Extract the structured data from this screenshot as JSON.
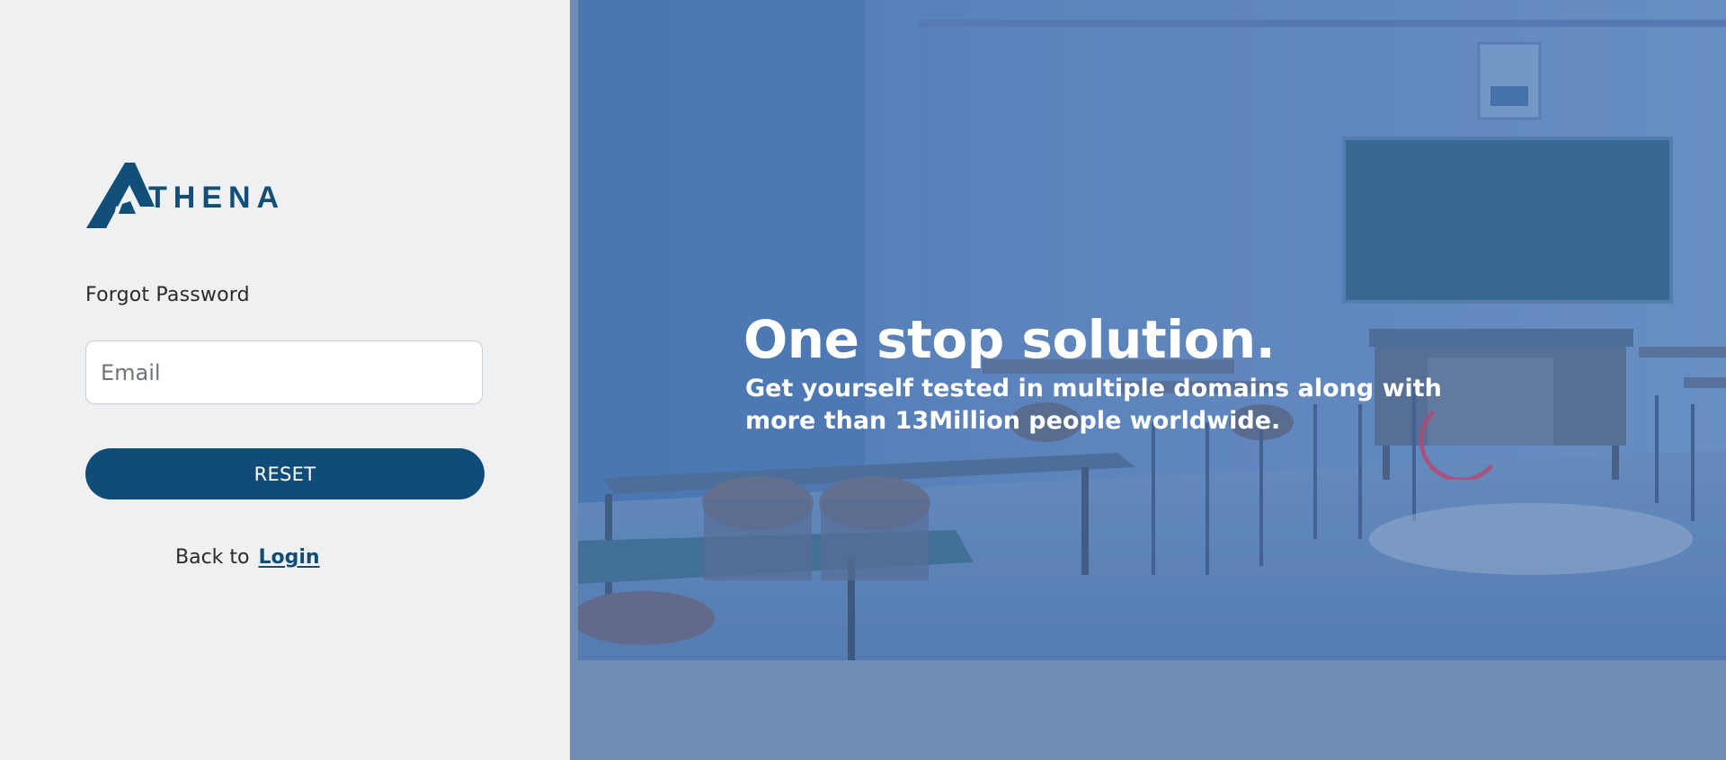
{
  "brand": {
    "name": "THENA",
    "logo_icon": "athena-a-mark",
    "color": "#114e78"
  },
  "form": {
    "title": "Forgot Password",
    "email_placeholder": "Email",
    "email_value": "",
    "reset_label": "RESET",
    "back_text": "Back to",
    "login_link": "Login"
  },
  "hero": {
    "headline": "One stop solution.",
    "subline": "Get yourself tested in multiple domains along with more than 13Million people worldwide.",
    "background_image": "classroom-photo",
    "spinner_icon": "loading-spinner-icon"
  },
  "colors": {
    "left_background": "#eff0f2",
    "accent": "#0f4d78",
    "right_background": "#6e8db3",
    "spinner": "#b04a78"
  }
}
